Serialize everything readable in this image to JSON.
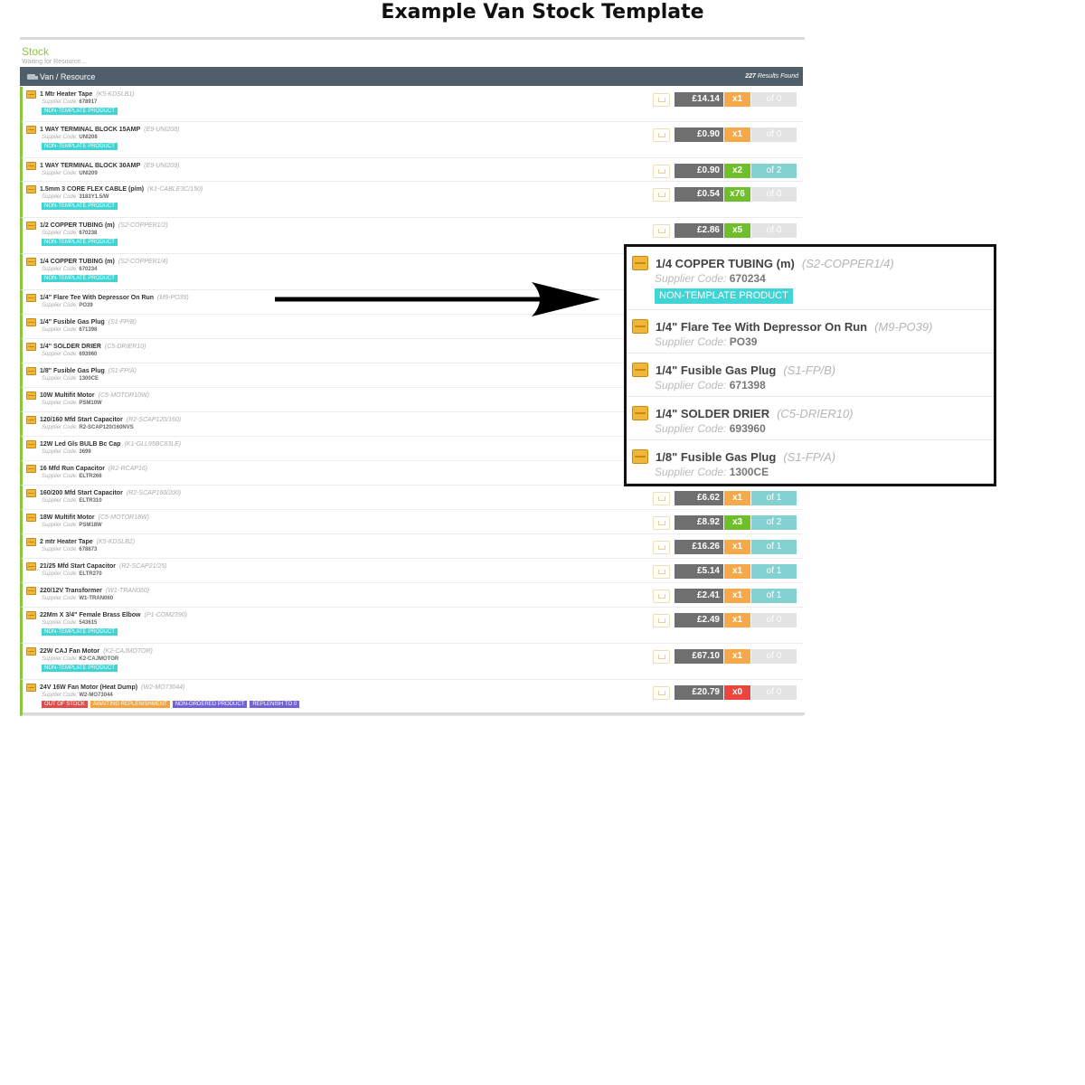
{
  "doc_title": "Example Van Stock Template",
  "page": {
    "title": "Stock",
    "subtitle": "Waiting for Resource..."
  },
  "table": {
    "header": "Van / Resource",
    "results_count": "227",
    "results_suffix": "Results Found"
  },
  "supplier_label": "Supplier Code:",
  "items": [
    {
      "name": "1 Mtr Heater Tape",
      "code": "(K5-KDSLB1)",
      "supplier_code": "678917",
      "tags": [
        "NON-TEMPLATE PRODUCT"
      ],
      "price": "£14.14",
      "qty": "x1",
      "qty_color": "orange",
      "of": "of 0",
      "of_color": "grey"
    },
    {
      "name": "1 WAY TERMINAL BLOCK 15AMP",
      "code": "(E9-UNI208)",
      "supplier_code": "UNI208",
      "tags": [
        "NON-TEMPLATE PRODUCT"
      ],
      "price": "£0.90",
      "qty": "x1",
      "qty_color": "orange",
      "of": "of 0",
      "of_color": "grey"
    },
    {
      "name": "1 WAY TERMINAL BLOCK 30AMP",
      "code": "(E9-UNI209)",
      "supplier_code": "UNI209",
      "tags": [],
      "price": "£0.90",
      "qty": "x2",
      "qty_color": "green",
      "of": "of 2",
      "of_color": "teal"
    },
    {
      "name": "1.5mm 3 CORE FLEX CABLE (p/m)",
      "code": "(K1-CABLE3C/150)",
      "supplier_code": "3183Y1.5/W",
      "tags": [
        "NON-TEMPLATE PRODUCT"
      ],
      "price": "£0.54",
      "qty": "x76",
      "qty_color": "green",
      "of": "of 0",
      "of_color": "grey"
    },
    {
      "name": "1/2 COPPER TUBING (m)",
      "code": "(S2-COPPER1/2)",
      "supplier_code": "670238",
      "tags": [
        "NON-TEMPLATE PRODUCT"
      ],
      "price": "£2.86",
      "qty": "x5",
      "qty_color": "green",
      "of": "of 0",
      "of_color": "grey"
    },
    {
      "name": "1/4 COPPER TUBING (m)",
      "code": "(S2-COPPER1/4)",
      "supplier_code": "670234",
      "tags": [
        "NON-TEMPLATE PRODUCT"
      ]
    },
    {
      "name": "1/4\" Flare Tee With Depressor On Run",
      "code": "(M9-PO39)",
      "supplier_code": "PO39",
      "tags": []
    },
    {
      "name": "1/4\" Fusible Gas Plug",
      "code": "(S1-FP/B)",
      "supplier_code": "671398",
      "tags": []
    },
    {
      "name": "1/4\" SOLDER DRIER",
      "code": "(C5-DRIER10)",
      "supplier_code": "693960",
      "tags": []
    },
    {
      "name": "1/8\" Fusible Gas Plug",
      "code": "(S1-FP/A)",
      "supplier_code": "1300CE",
      "tags": []
    },
    {
      "name": "10W Multifit Motor",
      "code": "(C5-MOTOR10W)",
      "supplier_code": "PSM10W",
      "tags": []
    },
    {
      "name": "120/160 Mfd Start Capacitor",
      "code": "(R2-SCAP120/160)",
      "supplier_code": "R2-SCAP120/160NVS",
      "tags": []
    },
    {
      "name": "12W Led Gls BULB Bc Cap",
      "code": "(K1-GLL95BC83LE)",
      "supplier_code": "3699",
      "tags": []
    },
    {
      "name": "16 Mfd Run Capacitor",
      "code": "(R2-RCAP16)",
      "supplier_code": "ELTR266",
      "tags": []
    },
    {
      "name": "160/200 Mfd Start Capacitor",
      "code": "(R2-SCAP160/200)",
      "supplier_code": "ELTR310",
      "tags": [],
      "price": "£6.62",
      "qty": "x1",
      "qty_color": "orange",
      "of": "of 1",
      "of_color": "teal"
    },
    {
      "name": "18W Multifit Motor",
      "code": "(C5-MOTOR18W)",
      "supplier_code": "PSM18W",
      "tags": [],
      "price": "£8.92",
      "qty": "x3",
      "qty_color": "green",
      "of": "of 2",
      "of_color": "teal"
    },
    {
      "name": "2 mtr Heater Tape",
      "code": "(K5-KDSLB2)",
      "supplier_code": "678873",
      "tags": [],
      "price": "£16.26",
      "qty": "x1",
      "qty_color": "orange",
      "of": "of 1",
      "of_color": "teal"
    },
    {
      "name": "21/25 Mfd Start Capacitor",
      "code": "(R2-SCAP21/25)",
      "supplier_code": "ELTR270",
      "tags": [],
      "price": "£5.14",
      "qty": "x1",
      "qty_color": "orange",
      "of": "of 1",
      "of_color": "teal"
    },
    {
      "name": "220/12V Transformer",
      "code": "(W1-TRAN060)",
      "supplier_code": "W1-TRAN060",
      "tags": [],
      "price": "£2.41",
      "qty": "x1",
      "qty_color": "orange",
      "of": "of 1",
      "of_color": "teal"
    },
    {
      "name": "22Mm X 3/4\" Female Brass Elbow",
      "code": "(P1-COM2390)",
      "supplier_code": "543615",
      "tags": [
        "NON-TEMPLATE PRODUCT"
      ],
      "price": "£2.49",
      "qty": "x1",
      "qty_color": "orange",
      "of": "of 0",
      "of_color": "grey"
    },
    {
      "name": "22W CAJ Fan Motor",
      "code": "(K2-CAJMOTOR)",
      "supplier_code": "K2-CAJMOTOR",
      "tags": [
        "NON-TEMPLATE PRODUCT"
      ],
      "price": "£67.10",
      "qty": "x1",
      "qty_color": "orange",
      "of": "of 0",
      "of_color": "grey"
    },
    {
      "name": "24V 16W Fan Motor (Heat Dump)",
      "code": "(W2-MO73044)",
      "supplier_code": "W2-MO73044",
      "tags": [
        "OUT OF STOCK",
        "AWAITING REPLENISHMENT",
        "NON-ORDERED PRODUCT",
        "REPLENISH TO 0"
      ],
      "tag_colors": [
        "red",
        "orange",
        "purple",
        "purple"
      ],
      "price": "£20.79",
      "qty": "x0",
      "qty_color": "red",
      "of": "of 0",
      "of_color": "grey"
    }
  ],
  "zoom_items": [
    {
      "name": "1/4 COPPER TUBING (m)",
      "code": "(S2-COPPER1/4)",
      "supplier_code": "670234",
      "tag": "NON-TEMPLATE PRODUCT"
    },
    {
      "name": "1/4\" Flare Tee With Depressor On Run",
      "code": "(M9-PO39)",
      "supplier_code": "PO39"
    },
    {
      "name": "1/4\" Fusible Gas Plug",
      "code": "(S1-FP/B)",
      "supplier_code": "671398"
    },
    {
      "name": "1/4\" SOLDER DRIER",
      "code": "(C5-DRIER10)",
      "supplier_code": "693960"
    },
    {
      "name": "1/8\" Fusible Gas Plug",
      "code": "(S1-FP/A)",
      "supplier_code": "1300CE"
    }
  ]
}
